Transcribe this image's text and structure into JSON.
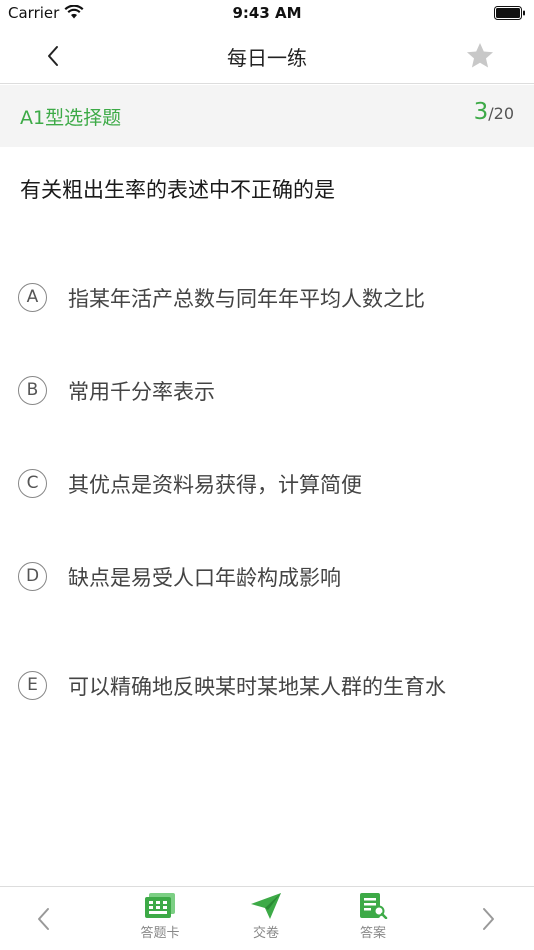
{
  "status_bar": {
    "carrier": "Carrier",
    "time": "9:43 AM"
  },
  "nav": {
    "title": "每日一练"
  },
  "question_type": {
    "label": "A1型选择题",
    "current": "3",
    "total": "/20"
  },
  "question": {
    "text": "有关粗出生率的表述中不正确的是"
  },
  "options": [
    {
      "letter": "A",
      "text": "指某年活产总数与同年年平均人数之比"
    },
    {
      "letter": "B",
      "text": "常用千分率表示"
    },
    {
      "letter": "C",
      "text": "其优点是资料易获得，计算简便"
    },
    {
      "letter": "D",
      "text": "缺点是易受人口年龄构成影响"
    },
    {
      "letter": "E",
      "text": "可以精确地反映某时某地某人群的生育水"
    }
  ],
  "toolbar": {
    "answer_card": "答题卡",
    "submit": "交卷",
    "answer": "答案"
  },
  "colors": {
    "accent": "#3daa47",
    "divider": "#dddddd",
    "band": "#f4f4f4"
  },
  "icons": {
    "back": "chevron-left-icon",
    "favorite": "star-icon",
    "prev": "chevron-left-icon",
    "next": "chevron-right-icon",
    "answer_card": "grid-card-icon",
    "submit": "paper-plane-icon",
    "answer": "document-search-icon"
  }
}
